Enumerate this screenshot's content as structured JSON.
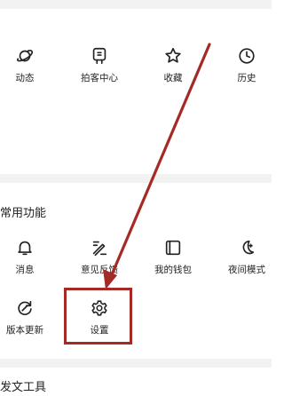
{
  "top_row": {
    "items": [
      {
        "label": "动态",
        "icon": "planet-icon"
      },
      {
        "label": "拍客中心",
        "icon": "camera-device-icon"
      },
      {
        "label": "收藏",
        "icon": "star-icon"
      },
      {
        "label": "历史",
        "icon": "clock-icon"
      }
    ]
  },
  "common_functions": {
    "title": "常用功能",
    "items": [
      {
        "label": "消息",
        "icon": "bell-icon"
      },
      {
        "label": "意见反馈",
        "icon": "feedback-pen-icon"
      },
      {
        "label": "我的钱包",
        "icon": "wallet-icon"
      },
      {
        "label": "夜间模式",
        "icon": "moon-icon"
      },
      {
        "label": "版本更新",
        "icon": "refresh-icon"
      },
      {
        "label": "设置",
        "icon": "gear-icon"
      }
    ]
  },
  "tools": {
    "title": "发文工具"
  },
  "annotation": {
    "color": "#a52a26",
    "target": "设置"
  }
}
